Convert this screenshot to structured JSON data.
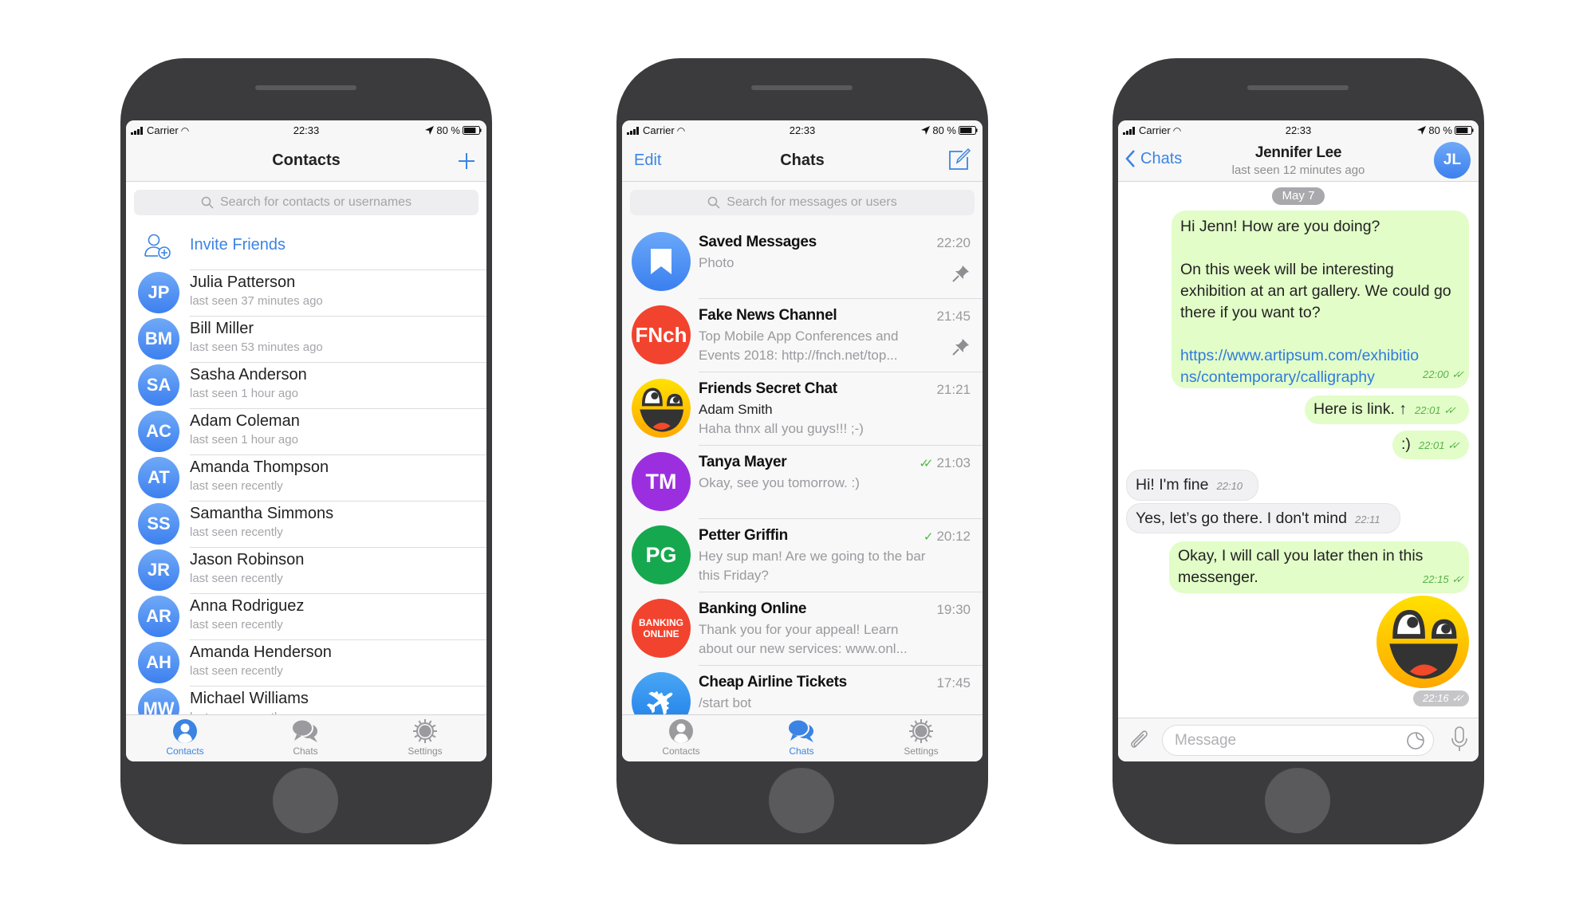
{
  "status_bar": {
    "carrier": "Carrier",
    "time": "22:33",
    "battery": "80 %",
    "battery_level": 0.8
  },
  "tab_bar": {
    "tabs": [
      "Contacts",
      "Chats",
      "Settings"
    ]
  },
  "contacts_screen": {
    "title": "Contacts",
    "add_icon": "plus-icon",
    "search_placeholder": "Search for contacts or usernames",
    "invite_label": "Invite Friends",
    "active_tab": "Contacts",
    "contacts": [
      {
        "initials": "JP",
        "name": "Julia Patterson",
        "status": "last seen 37 minutes ago"
      },
      {
        "initials": "BM",
        "name": "Bill Miller",
        "status": "last seen 53 minutes ago"
      },
      {
        "initials": "SA",
        "name": "Sasha Anderson",
        "status": "last seen 1 hour ago"
      },
      {
        "initials": "AC",
        "name": "Adam Coleman",
        "status": "last seen 1 hour ago"
      },
      {
        "initials": "AT",
        "name": "Amanda Thompson",
        "status": "last seen recently"
      },
      {
        "initials": "SS",
        "name": "Samantha Simmons",
        "status": "last seen recently"
      },
      {
        "initials": "JR",
        "name": "Jason Robinson",
        "status": "last seen recently"
      },
      {
        "initials": "AR",
        "name": "Anna Rodriguez",
        "status": "last seen recently"
      },
      {
        "initials": "AH",
        "name": "Amanda Henderson",
        "status": "last seen recently"
      },
      {
        "initials": "MW",
        "name": "Michael Williams",
        "status": "last seen recently"
      }
    ]
  },
  "chats_screen": {
    "edit_label": "Edit",
    "title": "Chats",
    "compose_icon": "compose-icon",
    "search_placeholder": "Search for messages or users",
    "active_tab": "Chats",
    "chats": [
      {
        "name": "Saved Messages",
        "time": "22:20",
        "preview": "Photo",
        "pinned": true,
        "avatar": {
          "type": "bookmark-icon",
          "color": "#4a8ff5"
        }
      },
      {
        "name": "Fake News Channel",
        "time": "21:45",
        "preview": "Top Mobile App Conferences and Events 2018: http://fnch.net/top...",
        "pinned": true,
        "avatar": {
          "type": "text",
          "text": "FNch",
          "color": "#f2432e"
        }
      },
      {
        "name": "Friends Secret Chat",
        "time": "21:21",
        "sender": "Adam Smith",
        "preview": "Haha thnx all you guys!!! ;-)",
        "avatar": {
          "type": "smiley-icon",
          "color": "#ffc800"
        }
      },
      {
        "name": "Tanya Mayer",
        "time": "21:03",
        "preview": "Okay, see you tomorrow. :)",
        "check": "read",
        "avatar": {
          "type": "text",
          "text": "TM",
          "color": "#9b2fe0"
        }
      },
      {
        "name": "Petter Griffin",
        "time": "20:12",
        "preview": "Hey sup man! Are we going to the bar this Friday?",
        "check": "sent",
        "avatar": {
          "type": "text",
          "text": "PG",
          "color": "#16a84e"
        }
      },
      {
        "name": "Banking Online",
        "time": "19:30",
        "preview": "Thank you for your appeal! Learn about our new services: www.onl...",
        "avatar": {
          "type": "text",
          "text": "BANKING ONLINE",
          "color": "#f2432e"
        }
      },
      {
        "name": "Cheap Airline Tickets",
        "time": "17:45",
        "preview": "/start bot",
        "avatar": {
          "type": "airplane-icon",
          "color": "#2f8ff0"
        }
      }
    ]
  },
  "conversation": {
    "back_label": "Chats",
    "contact_name": "Jennifer Lee",
    "contact_status": "last seen 12 minutes ago",
    "avatar_initials": "JL",
    "date_label": "May 7",
    "input_placeholder": "Message",
    "messages": [
      {
        "direction": "out",
        "text": "Hi Jenn! How are you doing?\n\nOn this week will be interesting exhibition at an art gallery. We could go there if you want to?",
        "link": "https://www.artipsum.com/exhibitions/contemporary/calligraphy",
        "time": "22:00",
        "check": "read"
      },
      {
        "direction": "out",
        "text": "Here is link. ↑",
        "time": "22:01",
        "check": "read"
      },
      {
        "direction": "out",
        "text": ":)",
        "time": "22:01",
        "check": "read"
      },
      {
        "direction": "in",
        "text": "Hi! I'm fine",
        "time": "22:10"
      },
      {
        "direction": "in",
        "text": "Yes, let’s go there. I don't mind",
        "time": "22:11"
      },
      {
        "direction": "out",
        "text": "Okay, I will call you later then in this messenger.",
        "time": "22:15",
        "check": "read"
      },
      {
        "direction": "out",
        "type": "sticker",
        "sticker": "smiley-icon",
        "time": "22:16",
        "check": "read"
      }
    ]
  },
  "colors": {
    "accent": "#3b84e3",
    "outgoing_bubble": "#e2fdc8",
    "incoming_bubble": "#f1f1f3",
    "read_check": "#4cb944",
    "phone_body": "#3b3b3d"
  }
}
